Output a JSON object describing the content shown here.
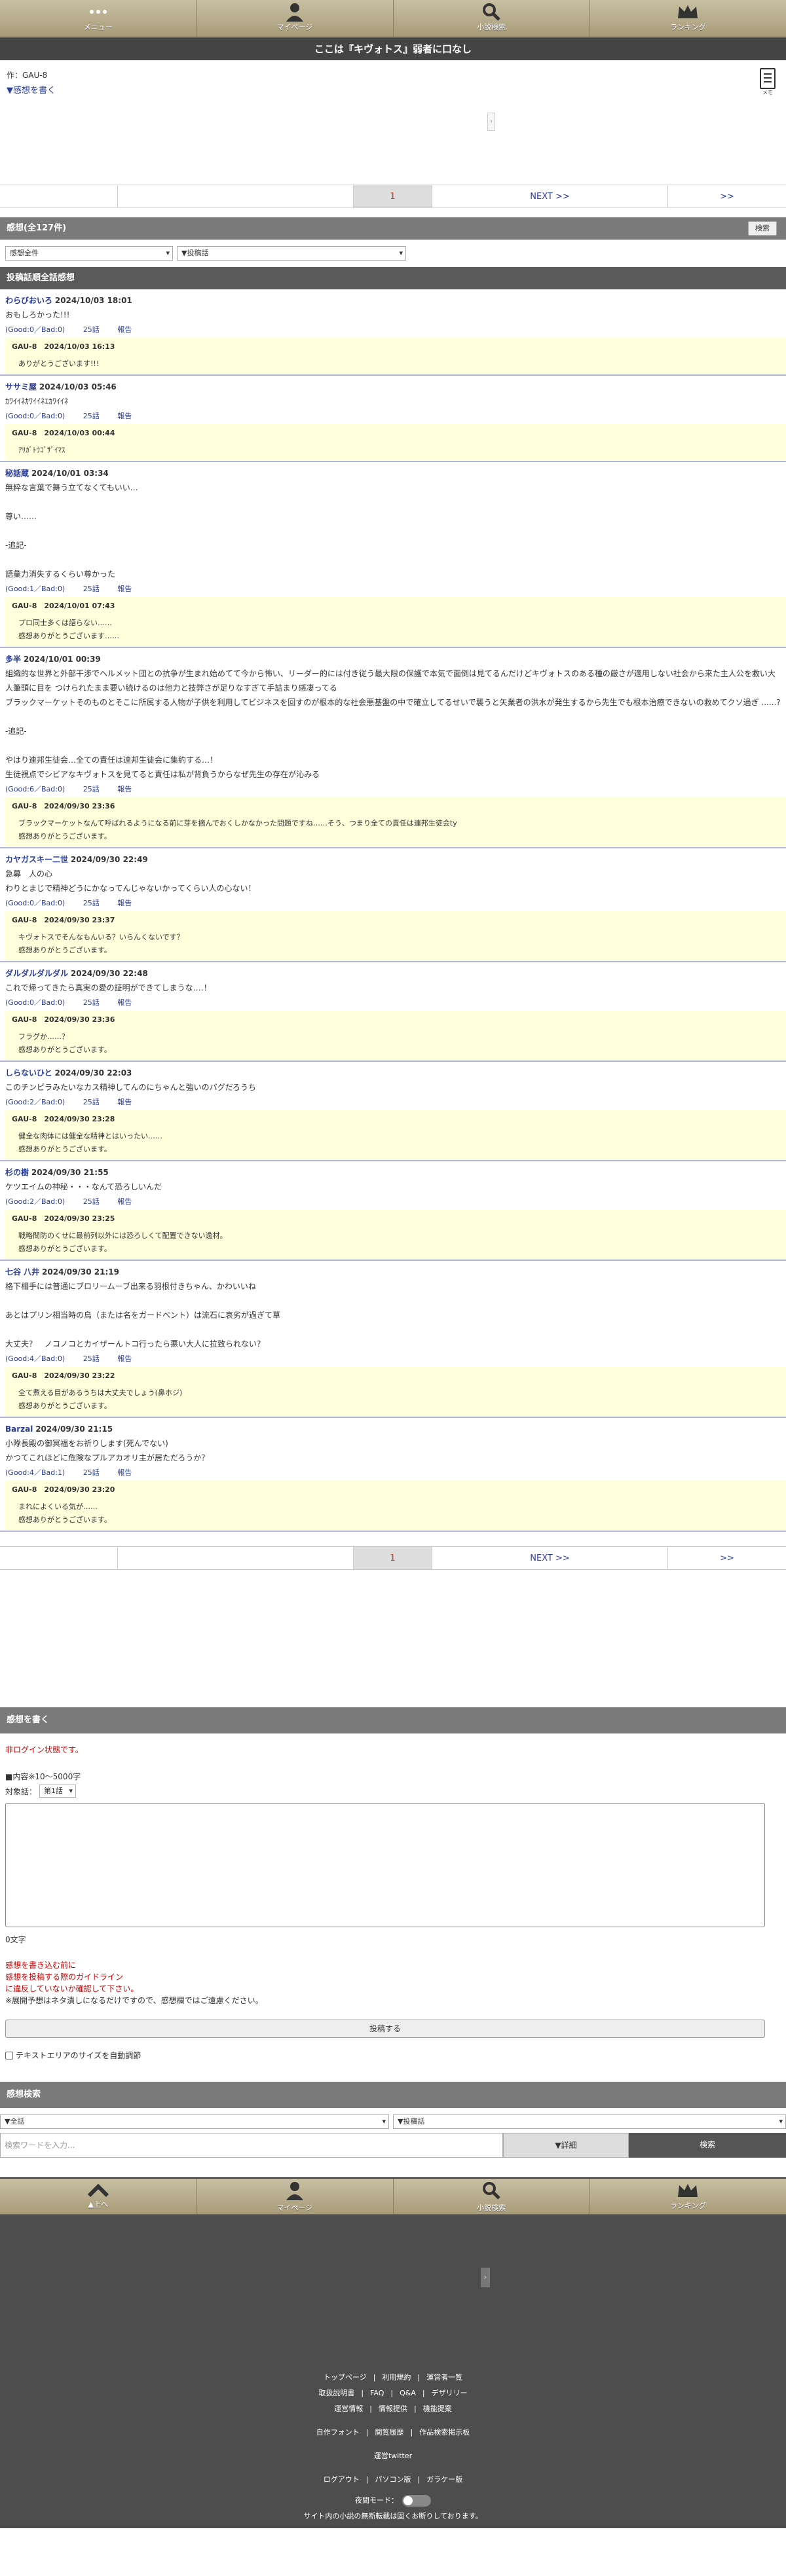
{
  "nav": {
    "menu": "メニュー",
    "mypage": "マイページ",
    "search": "小説検索",
    "ranking": "ランキング"
  },
  "novel_title": "ここは『キヴォトス』弱者に口なし",
  "author_line": "作：GAU-8",
  "write_link": "▼感想を書く",
  "memo_label": "メモ",
  "pager": {
    "current": "1",
    "next": "NEXT >>",
    "last": ">>"
  },
  "reviews_header": "感想(全127件)",
  "search_btn": "検索",
  "filter_all": "感想全件",
  "filter_ep": "▼投稿話",
  "section_title": "投稿話順全話感想",
  "reviews": [
    {
      "name": "わらびおいろ",
      "date": "2024/10/03 18:01",
      "body": [
        "おもしろかった!!!"
      ],
      "good": "(Good:0／Bad:0)",
      "ep": "25話",
      "report": "報告",
      "reply_head": "GAU-8　2024/10/03 16:13",
      "reply_body": [
        "ありがとうございます!!!"
      ]
    },
    {
      "name": "ササミ屋",
      "date": "2024/10/03 05:46",
      "body": [
        "ｶﾜｲｲﾈｶﾜｲｲﾈｴｶﾜｲｲﾈ"
      ],
      "good": "(Good:0／Bad:0)",
      "ep": "25話",
      "report": "報告",
      "reply_head": "GAU-8　2024/10/03 00:44",
      "reply_body": [
        "ｱﾘｶﾞﾄｳｺﾞｻﾞｲﾏｽ"
      ]
    },
    {
      "name": "秘話蔵",
      "date": "2024/10/01 03:34",
      "body": [
        "無粋な言葉で舞う立てなくてもいい…",
        "",
        "尊い……",
        "",
        "-追記-",
        "",
        "語彙力消失するくらい尊かった"
      ],
      "good": "(Good:1／Bad:0)",
      "ep": "25話",
      "report": "報告",
      "reply_head": "GAU-8　2024/10/01 07:43",
      "reply_body": [
        "プロ同士多くは語らない……",
        "感想ありがとうございます……"
      ]
    },
    {
      "name": "多半",
      "date": "2024/10/01 00:39",
      "body": [
        "組織的な世界と外部干渉でヘルメット団との抗争が生まれ始めてて今から怖い、リーダー的には付き従う最大限の保護で本気で面倒は見てるんだけどキヴォトスのある種の厳さが適用しない社会から来た主人公を救い大人筆頭に目を つけられたまま要い続けるのは他力と技弊さが足りなすぎて手詰まり感凄ってる",
        "ブラックマーケットそのものとそこに所属する人物が子供を利用してビジネスを回すのが根本的な社会悪基盤の中で確立してるせいで襲うと矢業者の洪水が発生するから先生でも根本治療できないの救めてクソ過ぎ ......?",
        "",
        "-追記-",
        "",
        "やはり連邦生徒会…全ての責任は連邦生徒会に集約する…！",
        "生徒視点でシビアなキヴォトスを見てると責任は私が背負うからなぜ先生の存在が沁みる"
      ],
      "good": "(Good:6／Bad:0)",
      "ep": "25話",
      "report": "報告",
      "reply_head": "GAU-8　2024/09/30 23:36",
      "reply_body": [
        "ブラックマーケットなんて呼ばれるようになる前に芽を摘んでおくしかなかった問題ですね……そう、つまり全ての責任は連邦生徒会ty",
        "感想ありがとうございます。"
      ]
    },
    {
      "name": "カヤガスキー二世",
      "date": "2024/09/30 22:49",
      "body": [
        "急募　人の心",
        "わりとまじで精神どうにかなってんじゃないかってくらい人の心ない！"
      ],
      "good": "(Good:0／Bad:0)",
      "ep": "25話",
      "report": "報告",
      "reply_head": "GAU-8　2024/09/30 23:37",
      "reply_body": [
        "キヴォトスでそんなもんいる？いらんくないです？",
        "感想ありがとうございます。"
      ]
    },
    {
      "name": "ダルダルダルダル",
      "date": "2024/09/30 22:48",
      "body": [
        "これで帰ってきたら真実の愛の証明ができてしまうな‥‥！"
      ],
      "good": "(Good:0／Bad:0)",
      "ep": "25話",
      "report": "報告",
      "reply_head": "GAU-8　2024/09/30 23:36",
      "reply_body": [
        "フラグか……？",
        "感想ありがとうございます。"
      ]
    },
    {
      "name": "しらないひと",
      "date": "2024/09/30 22:03",
      "body": [
        "このチンピラみたいなカス精神してんのにちゃんと強いのバグだろうち"
      ],
      "good": "(Good:2／Bad:0)",
      "ep": "25話",
      "report": "報告",
      "reply_head": "GAU-8　2024/09/30 23:28",
      "reply_body": [
        "健全な肉体には健全な精神とはいったい……",
        "感想ありがとうございます。"
      ]
    },
    {
      "name": "杉の樹",
      "date": "2024/09/30 21:55",
      "body": [
        "ケツエイムの神秘・・・なんて恐ろしいんだ"
      ],
      "good": "(Good:2／Bad:0)",
      "ep": "25話",
      "report": "報告",
      "reply_head": "GAU-8　2024/09/30 23:25",
      "reply_body": [
        "戦略間防のくせに最前列以外には恐ろしくて配置できない逸材。",
        "感想ありがとうございます。"
      ]
    },
    {
      "name": "七谷 八井",
      "date": "2024/09/30 21:19",
      "body": [
        "格下相手には普通にブロリームーブ出来る羽根付きちゃん、かわいいね",
        "",
        "あとはプリン相当時の鳥（または名をガードベント）は流石に哀劣が過ぎて草",
        "",
        "大丈夫？　ノコノコとカイザーんトコ行ったら悪い大人に拉致られない？"
      ],
      "good": "(Good:4／Bad:0)",
      "ep": "25話",
      "report": "報告",
      "reply_head": "GAU-8　2024/09/30 23:22",
      "reply_body": [
        "全て煮える目があるうちは大丈夫でしょう(鼻ホジ)",
        "感想ありがとうございます。"
      ]
    },
    {
      "name": "Barzal",
      "date": "2024/09/30 21:15",
      "body": [
        "小隊長殿の御冥福をお祈りします(死んでない)",
        "かつてこれほどに危険なプルアカオリ主が居ただろうか？"
      ],
      "good": "(Good:4／Bad:1)",
      "ep": "25話",
      "report": "報告",
      "reply_head": "GAU-8　2024/09/30 23:20",
      "reply_body": [
        "まれによくいる気が……",
        "感想ありがとうございます。"
      ]
    }
  ],
  "form": {
    "title": "感想を書く",
    "login_state": "非ログイン状態です。",
    "rule": "■内容※10〜5000字",
    "target_label": "対象話：",
    "target_value": "第1話",
    "count": "0文字",
    "warn1": "感想を書き込む前に",
    "warn2": "感想を投稿する際のガイドライン",
    "warn3": "に違反していないか確認して下さい。",
    "note": "※展開予想はネタ潰しになるだけですので、感想欄ではご遠慮ください。",
    "submit": "投稿する",
    "auto_resize": "テキストエリアのサイズを自動調節"
  },
  "search": {
    "title": "感想検索",
    "sel_all": "▼全話",
    "sel_ep": "▼投稿話",
    "placeholder": "検索ワードを入力...",
    "detail": "▼詳細",
    "button": "検索"
  },
  "footer_nav": {
    "top": "▲上へ",
    "mypage": "マイページ",
    "search": "小説検索",
    "ranking": "ランキング"
  },
  "footer_links": {
    "row1": [
      "トップページ",
      "利用規約",
      "運営者一覧"
    ],
    "row2": [
      "取扱説明書",
      "FAQ",
      "Q&A",
      "デザリリー"
    ],
    "row3": [
      "運営情報",
      "情報提供",
      "機能提案"
    ],
    "row4": [
      "自作フォント",
      "閲覧履歴",
      "作品検索掲示板"
    ],
    "row5": [
      "運営twitter"
    ],
    "row6": [
      "ログアウト",
      "パソコン版",
      "ガラケー版"
    ],
    "night": "夜間モード：",
    "notice": "サイト内の小説の無断転載は固くお断りしております。"
  }
}
